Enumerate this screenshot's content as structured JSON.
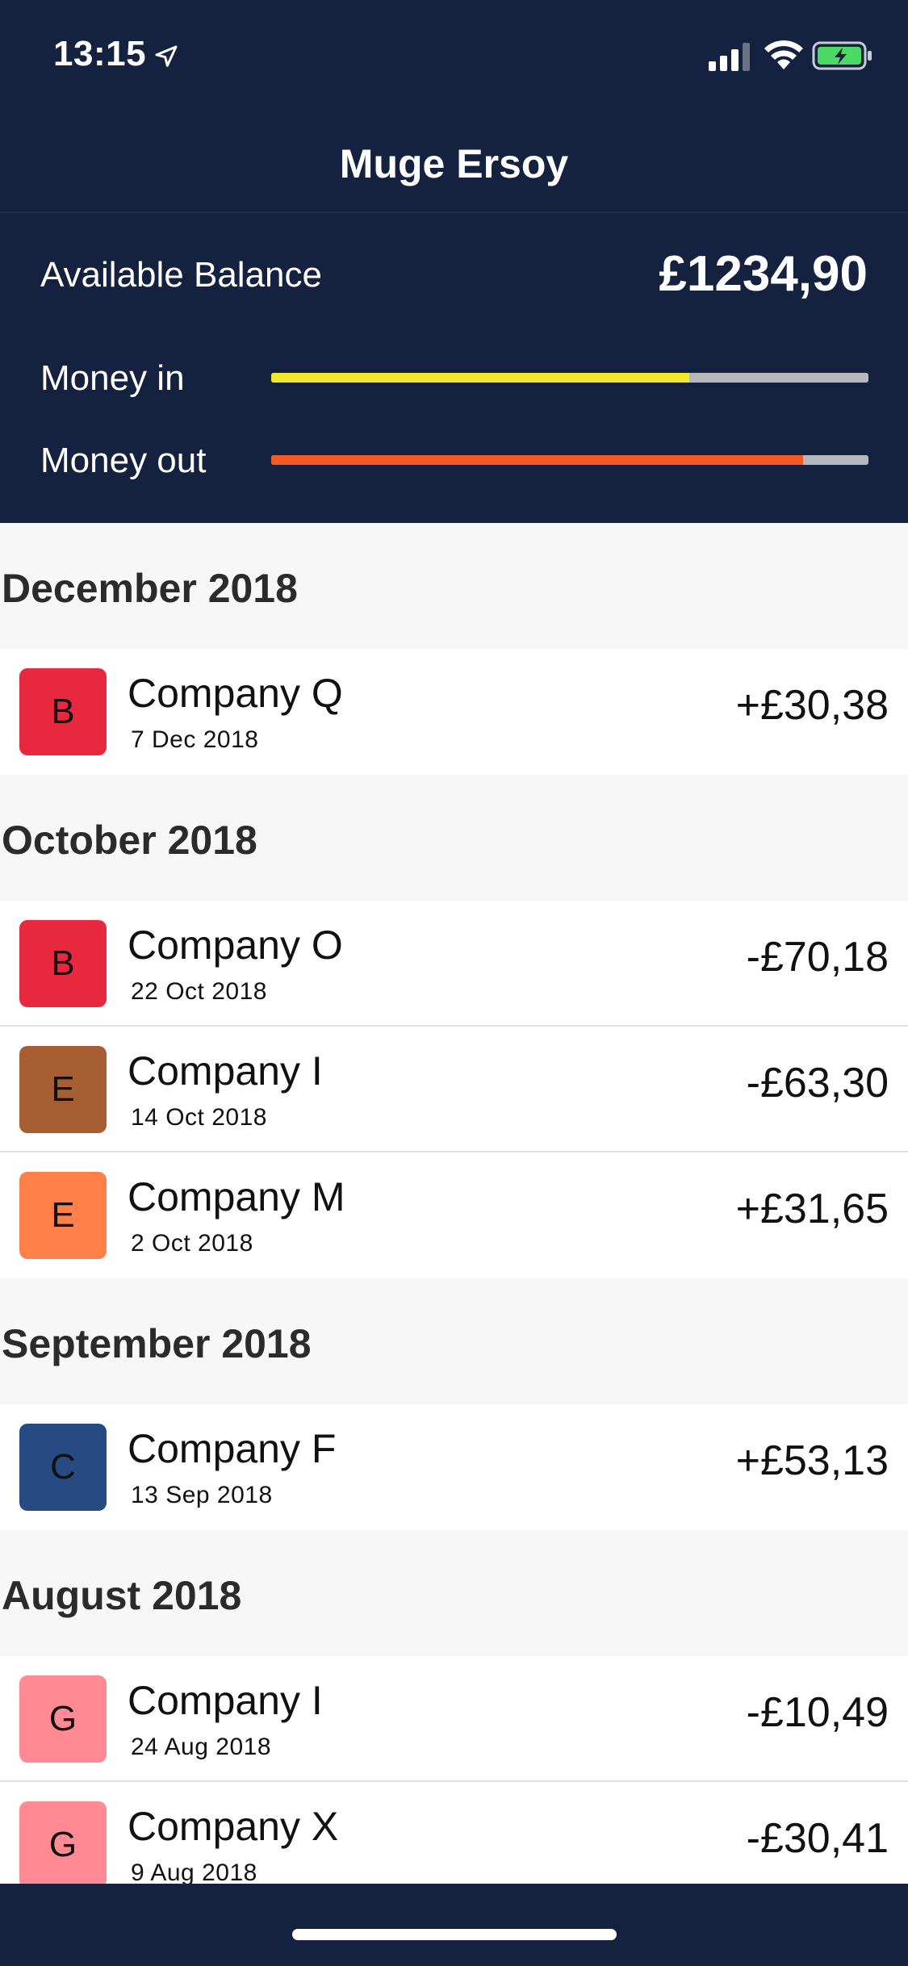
{
  "status_bar": {
    "time": "13:15",
    "icons": [
      "location-arrow-icon",
      "cellular-signal-icon",
      "wifi-icon",
      "battery-charging-icon"
    ]
  },
  "nav": {
    "title": "Muge Ersoy"
  },
  "summary": {
    "balance_label": "Available Balance",
    "balance_value": "£1234,90",
    "money_in": {
      "label": "Money in",
      "fraction": 0.7,
      "color": "#f4e82b"
    },
    "money_out": {
      "label": "Money out",
      "fraction": 0.89,
      "color": "#f45a25"
    }
  },
  "colors": {
    "header_bg": "#15223f",
    "list_bg": "#f7f7f7",
    "track": "#b7b8bd"
  },
  "sections": [
    {
      "title": "December 2018",
      "items": [
        {
          "initial": "B",
          "color": "#e8283f",
          "name": "Company Q",
          "date": "7 Dec 2018",
          "amount": "+£30,38"
        }
      ]
    },
    {
      "title": "October 2018",
      "items": [
        {
          "initial": "B",
          "color": "#e8283f",
          "name": "Company O",
          "date": "22 Oct 2018",
          "amount": "-£70,18"
        },
        {
          "initial": "E",
          "color": "#a85e33",
          "name": "Company I",
          "date": "14 Oct 2018",
          "amount": "-£63,30"
        },
        {
          "initial": "E",
          "color": "#ff7f4a",
          "name": "Company M",
          "date": "2 Oct 2018",
          "amount": "+£31,65"
        }
      ]
    },
    {
      "title": "September 2018",
      "items": [
        {
          "initial": "C",
          "color": "#264a82",
          "name": "Company F",
          "date": "13 Sep 2018",
          "amount": "+£53,13"
        }
      ]
    },
    {
      "title": "August 2018",
      "items": [
        {
          "initial": "G",
          "color": "#ff8a94",
          "name": "Company I",
          "date": "24 Aug 2018",
          "amount": "-£10,49"
        },
        {
          "initial": "G",
          "color": "#ff8a94",
          "name": "Company X",
          "date": "9 Aug 2018",
          "amount": "-£30,41"
        }
      ]
    }
  ]
}
